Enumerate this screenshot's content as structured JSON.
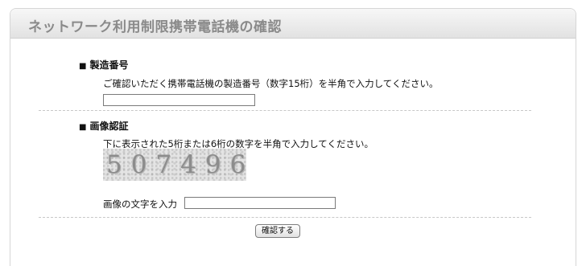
{
  "header": {
    "title": "ネットワーク利用制限携帯電話機の確認"
  },
  "serial_section": {
    "bullet": "■",
    "heading": "製造番号",
    "description": "ご確認いただく携帯電話機の製造番号（数字15桁）を半角で入力してください。",
    "input_value": ""
  },
  "captcha_section": {
    "bullet": "■",
    "heading": "画像認証",
    "description": "下に表示された5桁または6桁の数字を半角で入力してください。",
    "captcha_text": "507496",
    "input_label": "画像の文字を入力",
    "input_value": ""
  },
  "actions": {
    "submit_label": "確認する"
  }
}
